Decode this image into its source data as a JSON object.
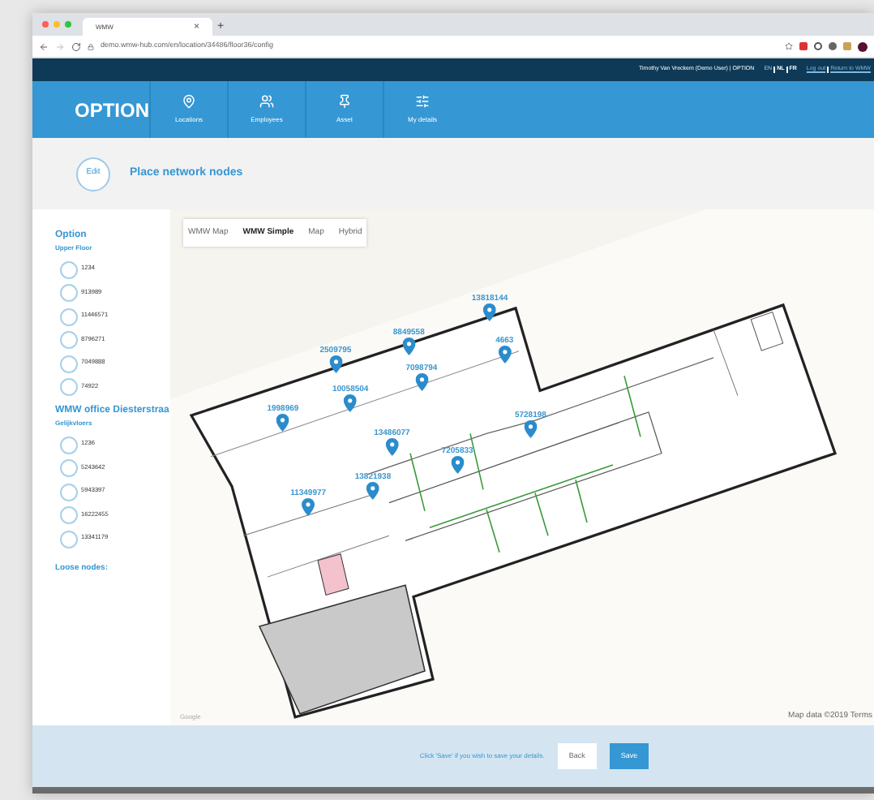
{
  "browser": {
    "tab_title": "WMW",
    "new_tab": "+",
    "close_tab": "×",
    "url": "demo.wmw-hub.com/en/location/34486/floor36/config"
  },
  "top_bar": {
    "user": "Timothy Van Vreckem (Demo User) | OPTION",
    "languages": [
      {
        "label": "EN",
        "selected": true
      },
      {
        "label": "NL",
        "selected": false
      },
      {
        "label": "FR",
        "selected": false
      }
    ],
    "links": [
      "Log out",
      "Return to WMW"
    ]
  },
  "brand": "OPTION",
  "nav": [
    {
      "label": "Locations",
      "kind": "pin"
    },
    {
      "label": "Employees",
      "kind": "users"
    },
    {
      "label": "Asset",
      "kind": "asset"
    },
    {
      "label": "My details",
      "kind": "sliders"
    }
  ],
  "page": {
    "badge": "Edit",
    "title": "Place network nodes"
  },
  "sidebar": {
    "groups": [
      {
        "name": "Option",
        "floor": "Upper Floor",
        "nodes": [
          "1234",
          "913989",
          "11446571",
          "8796271",
          "7049888",
          "74922"
        ]
      },
      {
        "name": "WMW office Diesterstraa",
        "floor": "Gelijkvloers",
        "nodes": [
          "1236",
          "5243642",
          "5943397",
          "16222455",
          "13341179"
        ]
      }
    ],
    "loose_title": "Loose nodes:"
  },
  "map": {
    "types": [
      {
        "label": "WMW Map",
        "selected": false
      },
      {
        "label": "WMW Simple",
        "selected": true
      },
      {
        "label": "Map",
        "selected": false
      },
      {
        "label": "Hybrid",
        "selected": false
      }
    ],
    "pins": [
      {
        "label": "13818144"
      },
      {
        "label": "8849558"
      },
      {
        "label": "4663"
      },
      {
        "label": "2509795"
      },
      {
        "label": "7098794"
      },
      {
        "label": "10058504"
      },
      {
        "label": "1998969"
      },
      {
        "label": "5728198"
      },
      {
        "label": "13486077"
      },
      {
        "label": "7205833"
      },
      {
        "label": "13821938"
      },
      {
        "label": "11349977"
      }
    ],
    "attribution": "Google",
    "map_data": "Map data ©2019  Terms"
  },
  "footer": {
    "message": "Click 'Save' if you wish to save your details.",
    "buttons": [
      "Back",
      "Save"
    ]
  }
}
